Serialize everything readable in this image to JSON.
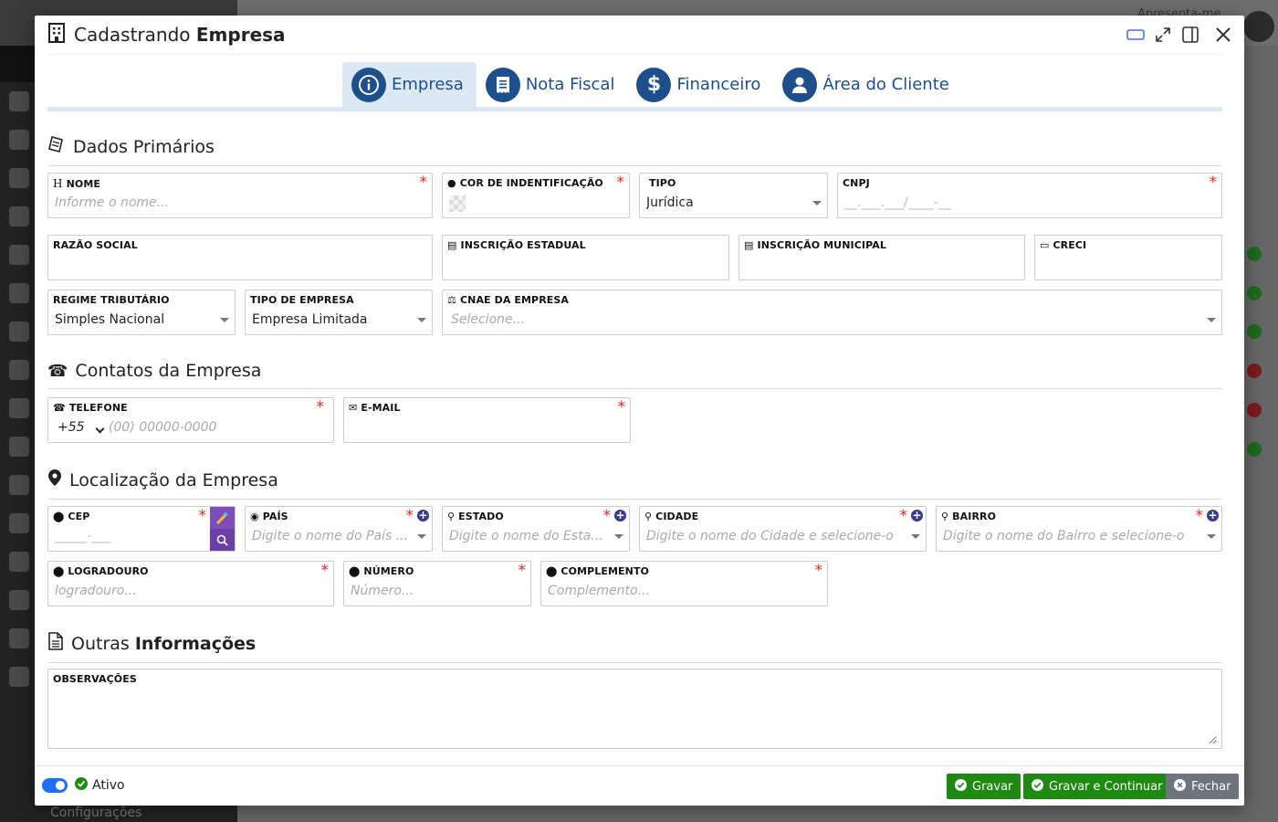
{
  "background": {
    "user_text": "Apresenta-me...",
    "sidebar_bottom_label": "Configurações"
  },
  "modal": {
    "title_prefix": "Cadastrando",
    "title_bold": "Empresa"
  },
  "tabs": [
    {
      "label": "Empresa",
      "icon": "info-icon",
      "active": true
    },
    {
      "label": "Nota Fiscal",
      "icon": "receipt-icon",
      "active": false
    },
    {
      "label": "Financeiro",
      "icon": "dollar-icon",
      "active": false
    },
    {
      "label": "Área do Cliente",
      "icon": "user-icon",
      "active": false
    }
  ],
  "sections": {
    "primarios": "Dados Primários",
    "contatos": "Contatos da Empresa",
    "localizacao": "Localização da Empresa",
    "outras_prefix": "Outras",
    "outras_bold": "Informações"
  },
  "fields": {
    "nome": {
      "label": "NOME",
      "placeholder": "Informe o nome..."
    },
    "cor": {
      "label": "COR DE INDENTIFICAÇÃO"
    },
    "tipo": {
      "label": "TIPO",
      "value": "Jurídica"
    },
    "cnpj": {
      "label": "CNPJ",
      "placeholder": "__.___.___/____-__"
    },
    "razao": {
      "label": "RAZÃO SOCIAL"
    },
    "ie": {
      "label": "INSCRIÇÃO ESTADUAL"
    },
    "im": {
      "label": "INSCRIÇÃO MUNICIPAL"
    },
    "creci": {
      "label": "CRECI"
    },
    "regime": {
      "label": "REGIME TRIBUTÁRIO",
      "value": "Simples Nacional"
    },
    "tipo_empresa": {
      "label": "TIPO DE EMPRESA",
      "value": "Empresa Limitada"
    },
    "cnae": {
      "label": "CNAE DA EMPRESA",
      "placeholder": "Selecione..."
    },
    "telefone": {
      "label": "TELEFONE",
      "ddi": "+55",
      "placeholder": "(00) 00000-0000"
    },
    "email": {
      "label": "E-MAIL"
    },
    "cep": {
      "label": "CEP",
      "placeholder": "_____-___"
    },
    "pais": {
      "label": "PAÍS",
      "placeholder": "Digite o nome do País ..."
    },
    "estado": {
      "label": "ESTADO",
      "placeholder": "Digite o nome do Esta..."
    },
    "cidade": {
      "label": "CIDADE",
      "placeholder": "Digite o nome do Cidade e selecione-o"
    },
    "bairro": {
      "label": "BAIRRO",
      "placeholder": "Digite o nome do Bairro e selecione-o"
    },
    "logradouro": {
      "label": "LOGRADOURO",
      "placeholder": "logradouro..."
    },
    "numero": {
      "label": "NÚMERO",
      "placeholder": "Número..."
    },
    "complemento": {
      "label": "COMPLEMENTO",
      "placeholder": "Complemento..."
    },
    "observacoes": {
      "label": "OBSERVAÇÕES"
    }
  },
  "footer": {
    "ativo_label": "Ativo",
    "ativo_on": true,
    "gravar": "Gravar",
    "gravar_continuar": "Gravar e Continuar",
    "fechar": "Fechar"
  },
  "colors": {
    "primary": "#1d4f8c",
    "tab_active_bg": "#dde8f5",
    "required": "#e22222",
    "green_button": "#1f8a12",
    "gray_button": "#6c757d",
    "toggle": "#1e6ff1",
    "cep_button": "#7c4dbb"
  }
}
